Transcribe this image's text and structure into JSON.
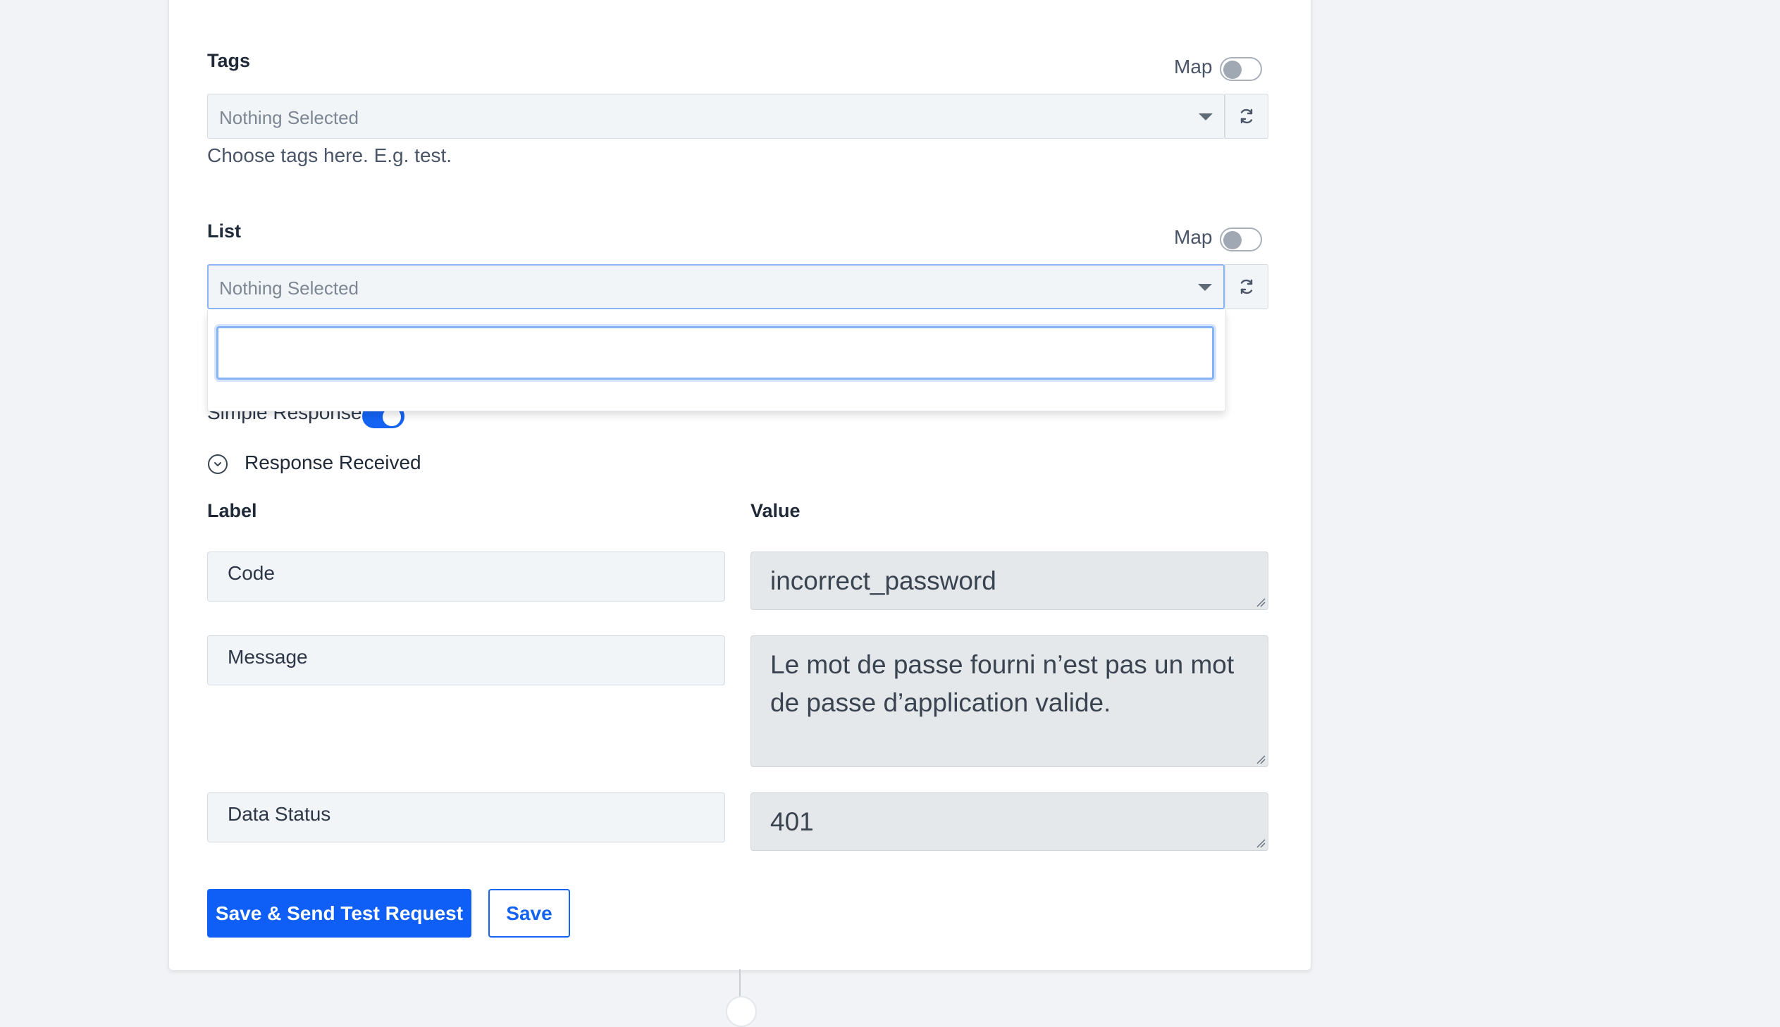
{
  "tags": {
    "label": "Tags",
    "map_label": "Map",
    "map_on": false,
    "placeholder": "Nothing Selected",
    "help_text": "Choose tags here. E.g. test."
  },
  "list": {
    "label": "List",
    "map_label": "Map",
    "map_on": false,
    "placeholder": "Nothing Selected",
    "search_value": ""
  },
  "simple_response": {
    "label": "Simple Response",
    "on": true
  },
  "response": {
    "section_title": "Response Received",
    "label_header": "Label",
    "value_header": "Value",
    "rows": [
      {
        "label": "Code",
        "value": "incorrect_password"
      },
      {
        "label": "Message",
        "value": "Le mot de passe fourni n’est pas un mot de passe d’application valide."
      },
      {
        "label": "Data Status",
        "value": "401"
      }
    ]
  },
  "buttons": {
    "save_send": "Save & Send Test Request",
    "save": "Save"
  },
  "colors": {
    "primary": "#0f5ef5",
    "background": "#f1f3f6",
    "card": "#ffffff"
  },
  "icons": {
    "refresh": "refresh-icon",
    "caret": "caret-down-icon",
    "chevron": "chevron-down-icon"
  }
}
